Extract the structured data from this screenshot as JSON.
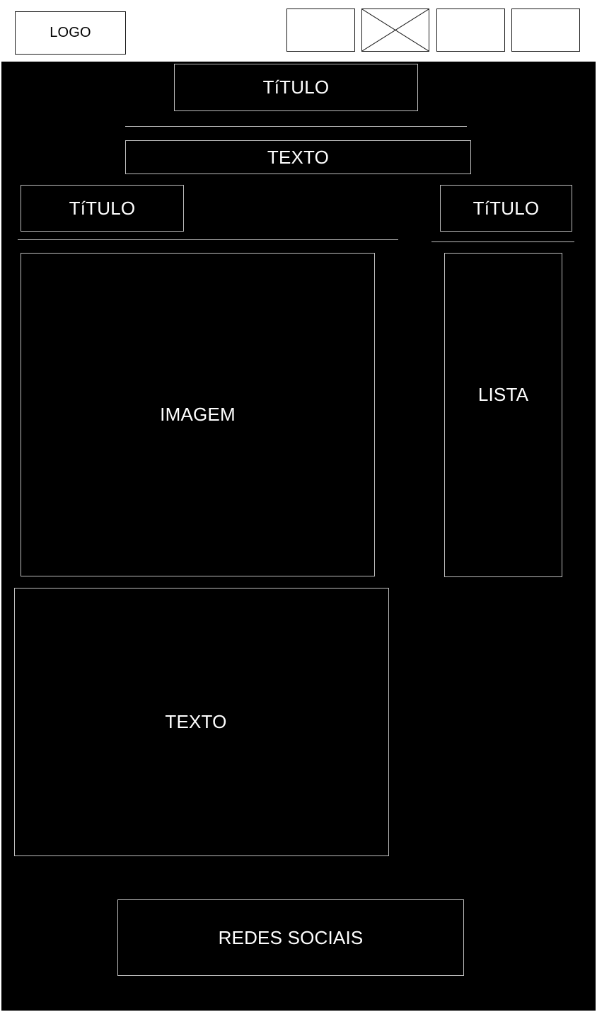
{
  "header": {
    "logo_label": "LOGO",
    "nav_items": [
      {
        "icon": "empty-placeholder"
      },
      {
        "icon": "image-placeholder-x"
      },
      {
        "icon": "empty-placeholder"
      },
      {
        "icon": "empty-placeholder"
      }
    ]
  },
  "main": {
    "title": "TíTULO",
    "intro_text": "TEXTO",
    "left_column": {
      "title": "TíTULO",
      "image_label": "IMAGEM",
      "text_label": "TEXTO"
    },
    "right_column": {
      "title": "TíTULO",
      "list_label": "LISTA"
    },
    "footer_label": "REDES SOCIAIS"
  },
  "colors": {
    "background": "#000000",
    "outline_light": "#bdbdbd",
    "outline_dark": "#1a1a1a",
    "text": "#ffffff"
  }
}
